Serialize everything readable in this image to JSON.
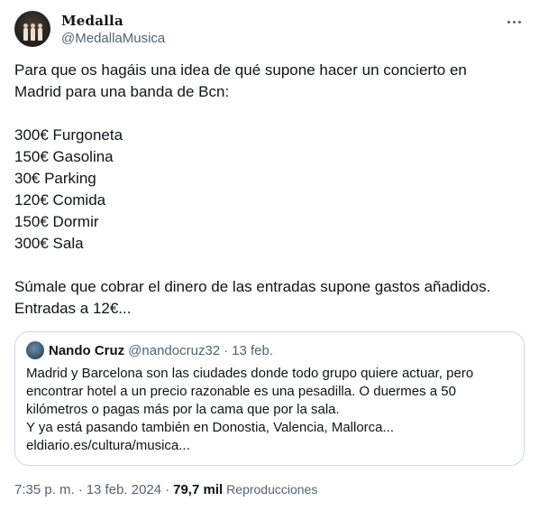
{
  "author": {
    "name": "Medalla",
    "handle": "@MedallaMusica"
  },
  "tweet": {
    "lines": [
      "Para que os hagáis una idea de qué supone hacer un concierto en",
      "Madrid para una banda de Bcn:",
      "",
      "300€ Furgoneta",
      "150€ Gasolina",
      "30€ Parking",
      "120€ Comida",
      "150€ Dormir",
      "300€ Sala",
      "",
      "Súmale que cobrar el dinero de las entradas supone gastos añadidos.",
      "Entradas a 12€..."
    ]
  },
  "quote": {
    "name": "Nando Cruz",
    "handle": "@nandocruz32",
    "separator": "·",
    "date": "13 feb.",
    "lines": [
      "Madrid y Barcelona son las ciudades donde todo grupo quiere actuar, pero",
      "encontrar hotel a un precio razonable es una pesadilla. O duermes a 50",
      "kilómetros o pagas más por la cama que por la sala.",
      "Y ya está pasando también en Donostia, Valencia, Mallorca...",
      "eldiario.es/cultura/musica..."
    ]
  },
  "meta": {
    "time": "7:35 p. m.",
    "separator": "·",
    "date": "13 feb. 2024",
    "views_count": "79,7 mil",
    "views_label": "Reproducciones"
  },
  "icons": {
    "more": "more-horizontal-icon"
  },
  "colors": {
    "text": "#0f1419",
    "secondary": "#536471",
    "border": "#cfd9de"
  }
}
